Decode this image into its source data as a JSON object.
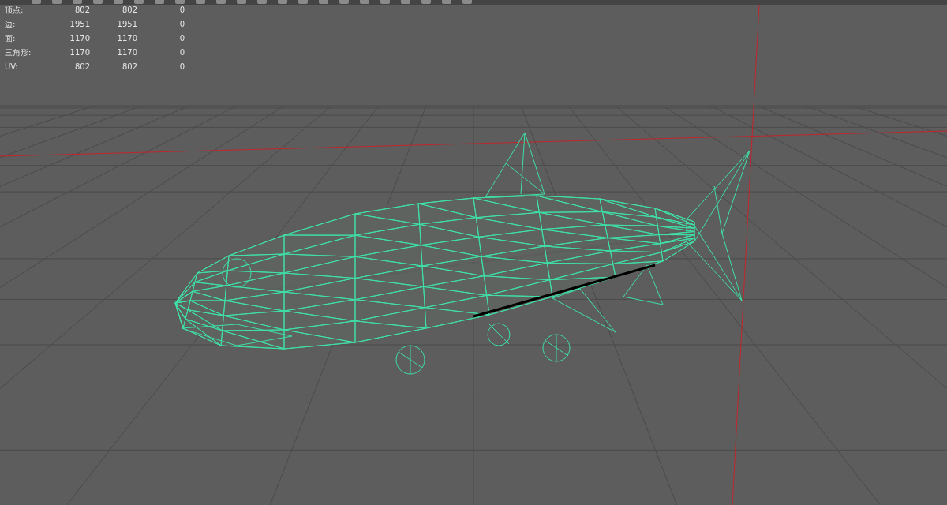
{
  "stats": [
    {
      "label": "顶点:",
      "values": [
        "802",
        "802",
        "0"
      ]
    },
    {
      "label": "边:",
      "values": [
        "1951",
        "1951",
        "0"
      ]
    },
    {
      "label": "面:",
      "values": [
        "1170",
        "1170",
        "0"
      ]
    },
    {
      "label": "三角形:",
      "values": [
        "1170",
        "1170",
        "0"
      ]
    },
    {
      "label": "UV:",
      "values": [
        "802",
        "802",
        "0"
      ]
    }
  ]
}
